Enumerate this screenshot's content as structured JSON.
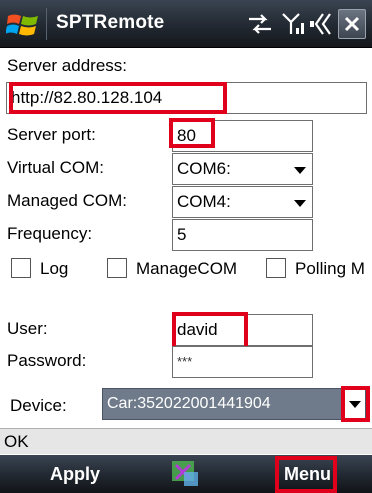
{
  "window": {
    "title": "SPTRemote"
  },
  "form": {
    "server_address_label": "Server address:",
    "server_address_value": "http://82.80.128.104",
    "server_port_label": "Server port:",
    "server_port_value": "80",
    "virtual_com_label": "Virtual COM:",
    "virtual_com_value": "COM6:",
    "managed_com_label": "Managed COM:",
    "managed_com_value": "COM4:",
    "frequency_label": "Frequency:",
    "frequency_value": "5",
    "checkboxes": [
      {
        "label": "Log",
        "checked": false
      },
      {
        "label": "ManageCOM",
        "checked": false
      },
      {
        "label": "Polling M",
        "checked": false
      }
    ],
    "user_label": "User:",
    "user_value": "david",
    "password_label": "Password:",
    "password_value": "***",
    "device_label": "Device:",
    "device_value": "Car:352022001441904"
  },
  "status": {
    "text": "OK"
  },
  "softkeys": {
    "left_label": "Apply",
    "right_label": "Menu"
  },
  "icons": {
    "start": "windows-flag-icon",
    "connectivity": "sync-arrows-icon",
    "signal": "signal-strength-icon",
    "volume": "speaker-volume-icon",
    "close": "close-icon",
    "keyboard": "input-panel-icon"
  },
  "colors": {
    "highlight": "#e0001b",
    "titlebar": "#262d36",
    "device_bg": "#6f7b8a"
  }
}
